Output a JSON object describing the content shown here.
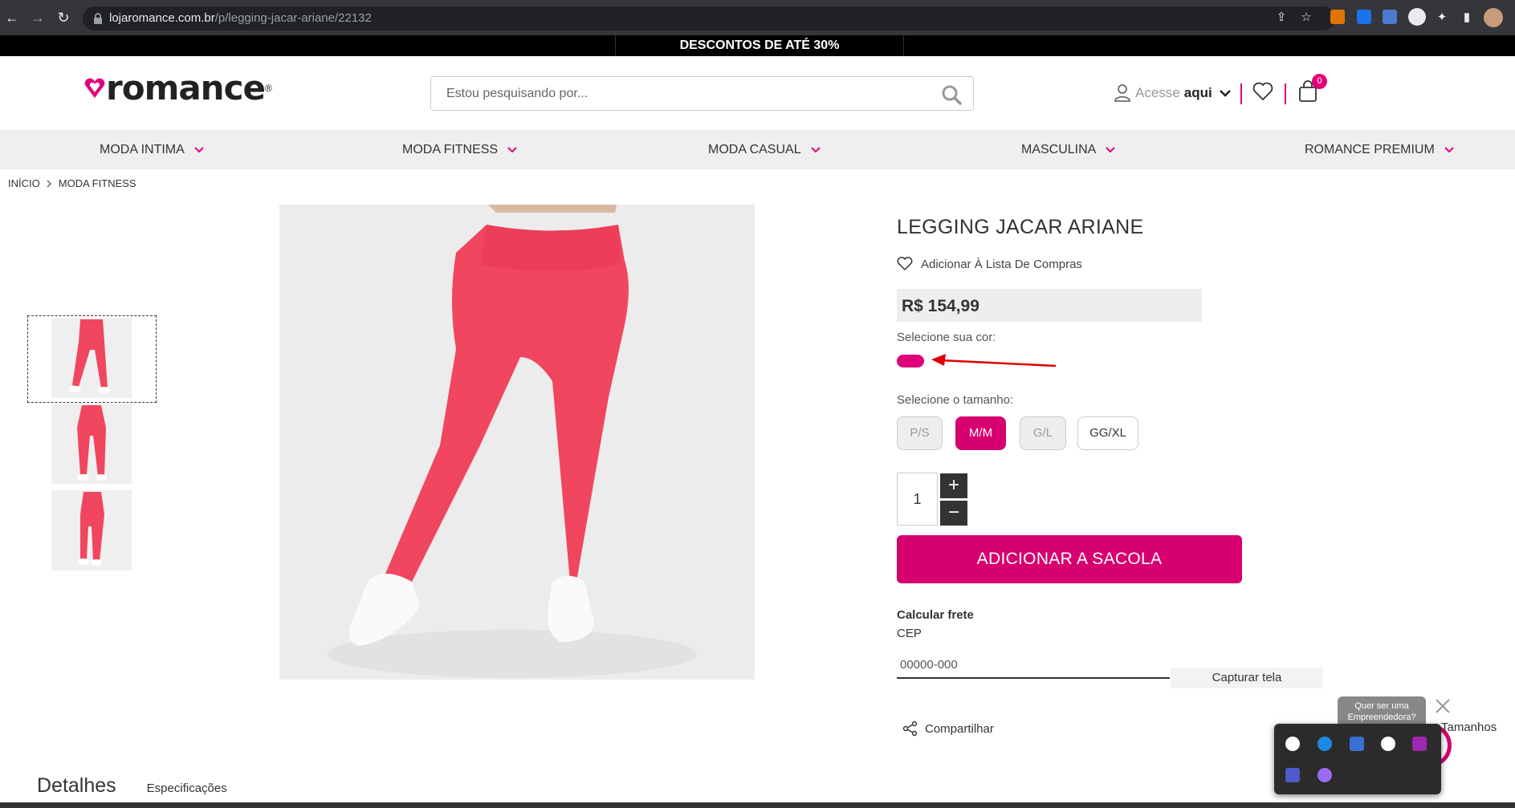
{
  "browser": {
    "url_domain": "lojaromance.com.br",
    "url_path": "/p/legging-jacar-ariane/22132"
  },
  "promo": {
    "text": "DESCONTOS DE ATÉ 30%"
  },
  "header": {
    "logo_text": "romance",
    "logo_reg": "®",
    "search_placeholder": "Estou pesquisando por...",
    "acesse_label": "Acesse",
    "aqui_label": "aqui",
    "cart_count": "0",
    "accent_color": "#e0007a"
  },
  "menu": {
    "items": [
      {
        "label": "MODA INTIMA"
      },
      {
        "label": "MODA FITNESS"
      },
      {
        "label": "MODA CASUAL"
      },
      {
        "label": "MASCULINA"
      },
      {
        "label": "ROMANCE PREMIUM"
      }
    ]
  },
  "breadcrumb": {
    "items": [
      "INÍCIO",
      "MODA FITNESS"
    ]
  },
  "product": {
    "title": "LEGGING JACAR ARIANE",
    "wishlist_label": "Adicionar À Lista De Compras",
    "price": "R$ 154,99",
    "color_label": "Selecione sua cor:",
    "size_label": "Selecione o tamanho:",
    "sizes": [
      {
        "label": "P/S",
        "state": "disabled"
      },
      {
        "label": "M/M",
        "state": "selected"
      },
      {
        "label": "G/L",
        "state": "disabled"
      },
      {
        "label": "GG/XL",
        "state": "available"
      }
    ],
    "quantity": "1",
    "add_to_bag_label": "ADICIONAR A SACOLA",
    "shipping_title": "Calcular frete",
    "cep_label": "CEP",
    "cep_placeholder": "00000-000",
    "share_label": "Compartilhar",
    "product_color": "#f0465f"
  },
  "tabs": {
    "details": "Detalhes",
    "specs": "Especificações"
  },
  "overlay": {
    "capture_label": "Capturar tela",
    "empreendedora_text": "Quer ser uma Empreendedora?",
    "tamanhos_label": "Tamanhos"
  }
}
